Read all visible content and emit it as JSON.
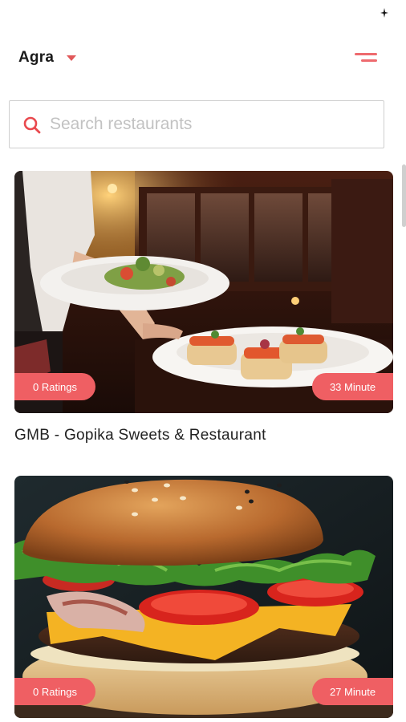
{
  "header": {
    "city": "Agra"
  },
  "search": {
    "placeholder": "Search restaurants",
    "value": ""
  },
  "restaurants": [
    {
      "name": "GMB - Gopika Sweets & Restaurant",
      "ratings_label": "0 Ratings",
      "time_label": "33 Minute",
      "image": "restaurant-waiter-serving-food-photo"
    },
    {
      "name": "",
      "ratings_label": "0 Ratings",
      "time_label": "27 Minute",
      "image": "burger-photo"
    }
  ],
  "colors": {
    "accent": "#ef5f63",
    "menu_icon": "#ee6a6e",
    "caret": "#e15759"
  }
}
